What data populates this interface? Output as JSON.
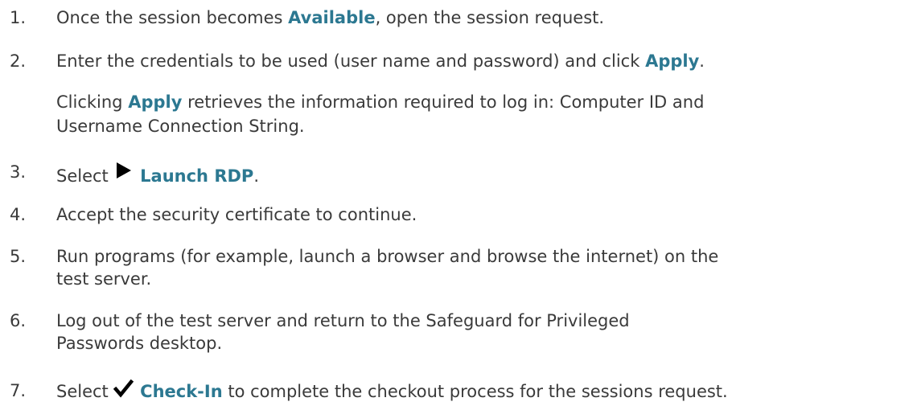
{
  "steps": [
    {
      "number": "1.",
      "t1": "Once the session becomes ",
      "b1": "Available",
      "t2": ", open the session request."
    },
    {
      "number": "2.",
      "t1": "Enter the credentials to be used (user name and password) and click ",
      "b1": "Apply",
      "t2": ".",
      "note_t1": "Clicking ",
      "note_b1": "Apply",
      "note_t2": " retrieves the information required to log in: Computer ID and",
      "note_line2": "Username Connection String."
    },
    {
      "number": "3.",
      "t1": "Select ",
      "icon": "play-icon",
      "b1": "Launch RDP",
      "t2": "."
    },
    {
      "number": "4.",
      "t1": "Accept the security certificate to continue."
    },
    {
      "number": "5.",
      "line1": "Run programs (for example, launch a browser and browse the internet) on the",
      "line2": "test server."
    },
    {
      "number": "6.",
      "line1": "Log out of the test server and return to the Safeguard for Privileged",
      "line2": "Passwords  desktop."
    },
    {
      "number": "7.",
      "t1": "Select ",
      "icon": "checkmark-icon",
      "b1": "Check-In",
      "t2": " to complete the checkout process for the sessions request."
    }
  ],
  "colors": {
    "text": "#3a3a3a",
    "emphasis": "#2c7891"
  }
}
